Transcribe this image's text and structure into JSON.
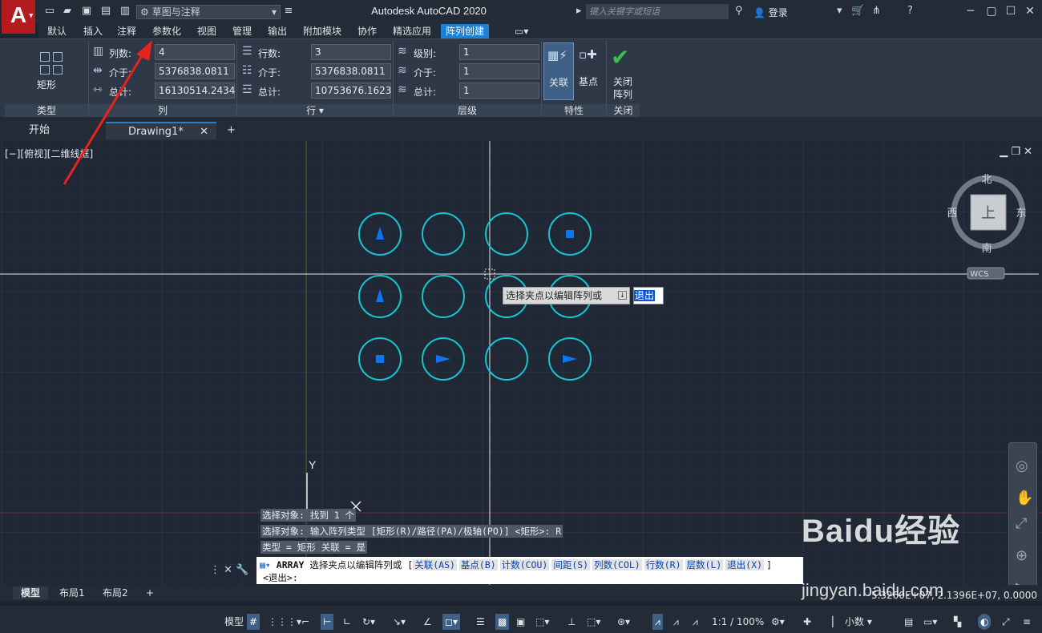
{
  "titlebar": {
    "app_title": "Autodesk AutoCAD 2020",
    "workspace": "草图与注释",
    "search_placeholder": "键入关键字或短语",
    "login": "登录"
  },
  "ribbon_tabs": [
    "默认",
    "插入",
    "注释",
    "参数化",
    "视图",
    "管理",
    "输出",
    "附加模块",
    "协作",
    "精选应用",
    "阵列创建"
  ],
  "ribbon": {
    "type_panel": {
      "button": "矩形",
      "title": "类型"
    },
    "columns_panel": {
      "title": "列",
      "count_label": "列数:",
      "count_value": "4",
      "between_label": "介于:",
      "between_value": "5376838.0811",
      "total_label": "总计:",
      "total_value": "16130514.2434"
    },
    "rows_panel": {
      "title": "行 ▾",
      "count_label": "行数:",
      "count_value": "3",
      "between_label": "介于:",
      "between_value": "5376838.0811",
      "total_label": "总计:",
      "total_value": "10753676.1623"
    },
    "levels_panel": {
      "title": "层级",
      "count_label": "级别:",
      "count_value": "1",
      "between_label": "介于:",
      "between_value": "1",
      "total_label": "总计:",
      "total_value": "1"
    },
    "properties_panel": {
      "title": "特性",
      "associative": "关联",
      "base_point": "基点"
    },
    "close_panel": {
      "title": "关闭",
      "button_line1": "关闭",
      "button_line2": "阵列"
    }
  },
  "doc_tabs": {
    "start": "开始",
    "drawing": "Drawing1*"
  },
  "viewport": {
    "label": "[−][俯视][二维线框]",
    "compass": {
      "north": "北",
      "south": "南",
      "east": "东",
      "west": "西",
      "top": "上",
      "wcs": "WCS"
    },
    "ucs_y": "Y",
    "grip_prompt": "选择夹点以编辑阵列或",
    "exit_option": "退出"
  },
  "command_history": [
    "选择对象: 找到 1 个",
    "选择对象:  输入阵列类型 [矩形(R)/路径(PA)/极轴(PO)] <矩形>: R",
    "类型 = 矩形  关联 = 是"
  ],
  "command_line": {
    "command": "ARRAY",
    "prompt": "选择夹点以编辑阵列或 [",
    "options": [
      "关联(AS)",
      "基点(B)",
      "计数(COU)",
      "间距(S)",
      "列数(COL)",
      "行数(R)",
      "层数(L)",
      "退出(X)"
    ],
    "close_bracket": "]",
    "default": "<退出>:"
  },
  "layout_tabs": [
    "模型",
    "布局1",
    "布局2"
  ],
  "coordinates": "5.3260E+07, 2.1396E+07, 0.0000",
  "statusbar": {
    "model": "模型",
    "scale": "1:1 / 100%",
    "units": "小数"
  },
  "watermark": {
    "brand": "Baidu经验",
    "url": "jingyan.baidu.com"
  },
  "colors": {
    "accent": "#1f7fd1",
    "circle": "#17c5d0",
    "marker": "#0f74f0",
    "annotation_arrow": "#e8231b"
  },
  "array_items": [
    {
      "row": 1,
      "col": 1,
      "marker": "triangle-up"
    },
    {
      "row": 1,
      "col": 2,
      "marker": "none"
    },
    {
      "row": 1,
      "col": 3,
      "marker": "none"
    },
    {
      "row": 1,
      "col": 4,
      "marker": "square"
    },
    {
      "row": 2,
      "col": 1,
      "marker": "triangle-up"
    },
    {
      "row": 2,
      "col": 2,
      "marker": "none"
    },
    {
      "row": 2,
      "col": 3,
      "marker": "none"
    },
    {
      "row": 2,
      "col": 4,
      "marker": "none"
    },
    {
      "row": 3,
      "col": 1,
      "marker": "square"
    },
    {
      "row": 3,
      "col": 2,
      "marker": "triangle-right"
    },
    {
      "row": 3,
      "col": 3,
      "marker": "none"
    },
    {
      "row": 3,
      "col": 4,
      "marker": "triangle-right"
    }
  ]
}
